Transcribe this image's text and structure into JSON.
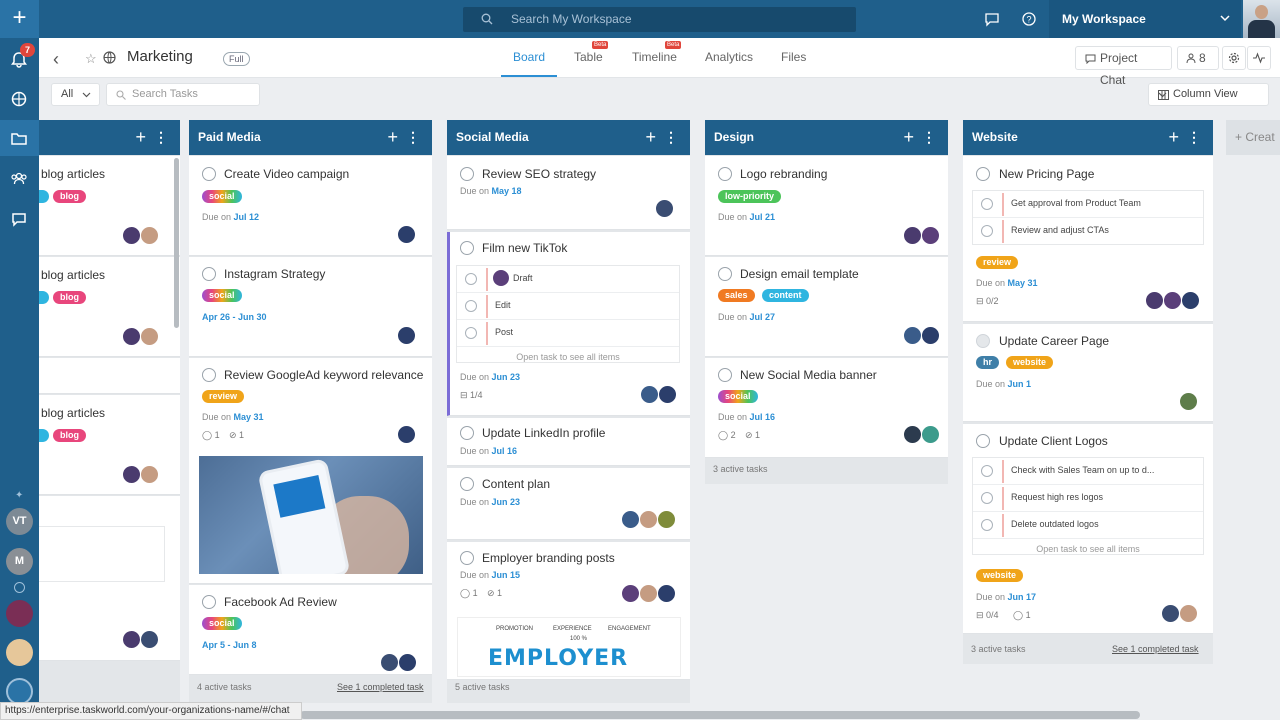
{
  "sidebar": {
    "notifications": "7",
    "avatars": [
      "VT",
      "M"
    ]
  },
  "search": {
    "placeholder": "Search My Workspace"
  },
  "workspace": {
    "label": "My Workspace"
  },
  "project": {
    "title": "Marketing",
    "badge": "Full"
  },
  "tabs": [
    {
      "label": "Board",
      "beta": ""
    },
    {
      "label": "Table",
      "beta": "Beta"
    },
    {
      "label": "Timeline",
      "beta": "Beta"
    },
    {
      "label": "Analytics",
      "beta": ""
    },
    {
      "label": "Files",
      "beta": ""
    }
  ],
  "header_buttons": {
    "project_chat": "Project Chat",
    "members": "8"
  },
  "toolbar": {
    "filter": "All",
    "search_placeholder": "Search Tasks",
    "view": "Column View"
  },
  "columns": [
    {
      "title": "",
      "cards": [
        {
          "title": "blog articles",
          "tags": [
            "blog"
          ]
        },
        {
          "title": "blog articles",
          "tags": [
            "blog"
          ]
        },
        {
          "title": "blog articles",
          "tags": [
            "blog"
          ]
        }
      ]
    },
    {
      "title": "Paid Media",
      "cards": [
        {
          "title": "Create Video campaign",
          "tag": "social",
          "due_prefix": "Due on",
          "due": "Jul 12"
        },
        {
          "title": "Instagram Strategy",
          "tag": "social",
          "due": "Apr 26 - Jun 30"
        },
        {
          "title": "Review GoogleAd keyword relevance",
          "tag": "review",
          "due_prefix": "Due on",
          "due": "May 31",
          "comments": "1",
          "attachments": "1"
        },
        {
          "title": "Facebook Ad Review",
          "tag": "social",
          "due": "Apr 5 - Jun 8"
        }
      ],
      "footer": "4 active tasks",
      "footer_link": "See 1 completed task"
    },
    {
      "title": "Social Media",
      "cards": [
        {
          "title": "Review SEO strategy",
          "due_prefix": "Due on",
          "due": "May 18"
        },
        {
          "title": "Film new TikTok",
          "checklist": [
            "Draft",
            "Edit",
            "Post"
          ],
          "open_task": "Open task to see all items",
          "due_prefix": "Due on",
          "due": "Jun 23",
          "progress": "1/4"
        },
        {
          "title": "Update LinkedIn profile",
          "due_prefix": "Due on",
          "due": "Jul 16"
        },
        {
          "title": "Content plan",
          "due_prefix": "Due on",
          "due": "Jun 23"
        },
        {
          "title": "Employer branding posts",
          "due_prefix": "Due on",
          "due": "Jun 15",
          "comments": "1",
          "attachments": "1",
          "image_text": "EMPLOYER",
          "image_labels": [
            "PROMOTION",
            "EXPERIENCE",
            "ENGAGEMENT"
          ],
          "image_pct": "100 %"
        }
      ],
      "footer": "5 active tasks"
    },
    {
      "title": "Design",
      "cards": [
        {
          "title": "Logo rebranding",
          "tag": "low-priority",
          "due_prefix": "Due on",
          "due": "Jul 21"
        },
        {
          "title": "Design email template",
          "tags": [
            "sales",
            "content"
          ],
          "due_prefix": "Due on",
          "due": "Jul 27"
        },
        {
          "title": "New Social Media banner",
          "tag": "social",
          "due_prefix": "Due on",
          "due": "Jul 16",
          "comments": "2",
          "attachments": "1"
        }
      ],
      "footer": "3 active tasks"
    },
    {
      "title": "Website",
      "cards": [
        {
          "title": "New Pricing Page",
          "checklist": [
            "Get approval from Product Team",
            "Review and adjust CTAs"
          ],
          "tag": "review",
          "due_prefix": "Due on",
          "due": "May 31",
          "progress": "0/2"
        },
        {
          "title": "Update Career Page",
          "tags": [
            "hr",
            "website"
          ],
          "due_prefix": "Due on",
          "due": "Jun 1"
        },
        {
          "title": "Update Client Logos",
          "checklist": [
            "Check with Sales Team on up to d...",
            "Request high res logos",
            "Delete outdated logos"
          ],
          "open_task": "Open task to see all items",
          "tag": "website",
          "due_prefix": "Due on",
          "due": "Jun 17",
          "progress": "0/4",
          "comments": "1"
        }
      ],
      "footer": "3 active tasks",
      "footer_link": "See 1 completed task"
    }
  ],
  "create_column": "Creat",
  "status_url": "https://enterprise.taskworld.com/your-organizations-name/#/chat",
  "colors": {
    "nav": "#1f5f8b",
    "accent": "#2c8fd4",
    "review": "#f0a419",
    "blog": "#e8467c",
    "sales": "#f07a22",
    "content": "#2fb5e0",
    "low_priority": "#4cc45a",
    "hr": "#3f7fa8",
    "website": "#f0a419"
  }
}
